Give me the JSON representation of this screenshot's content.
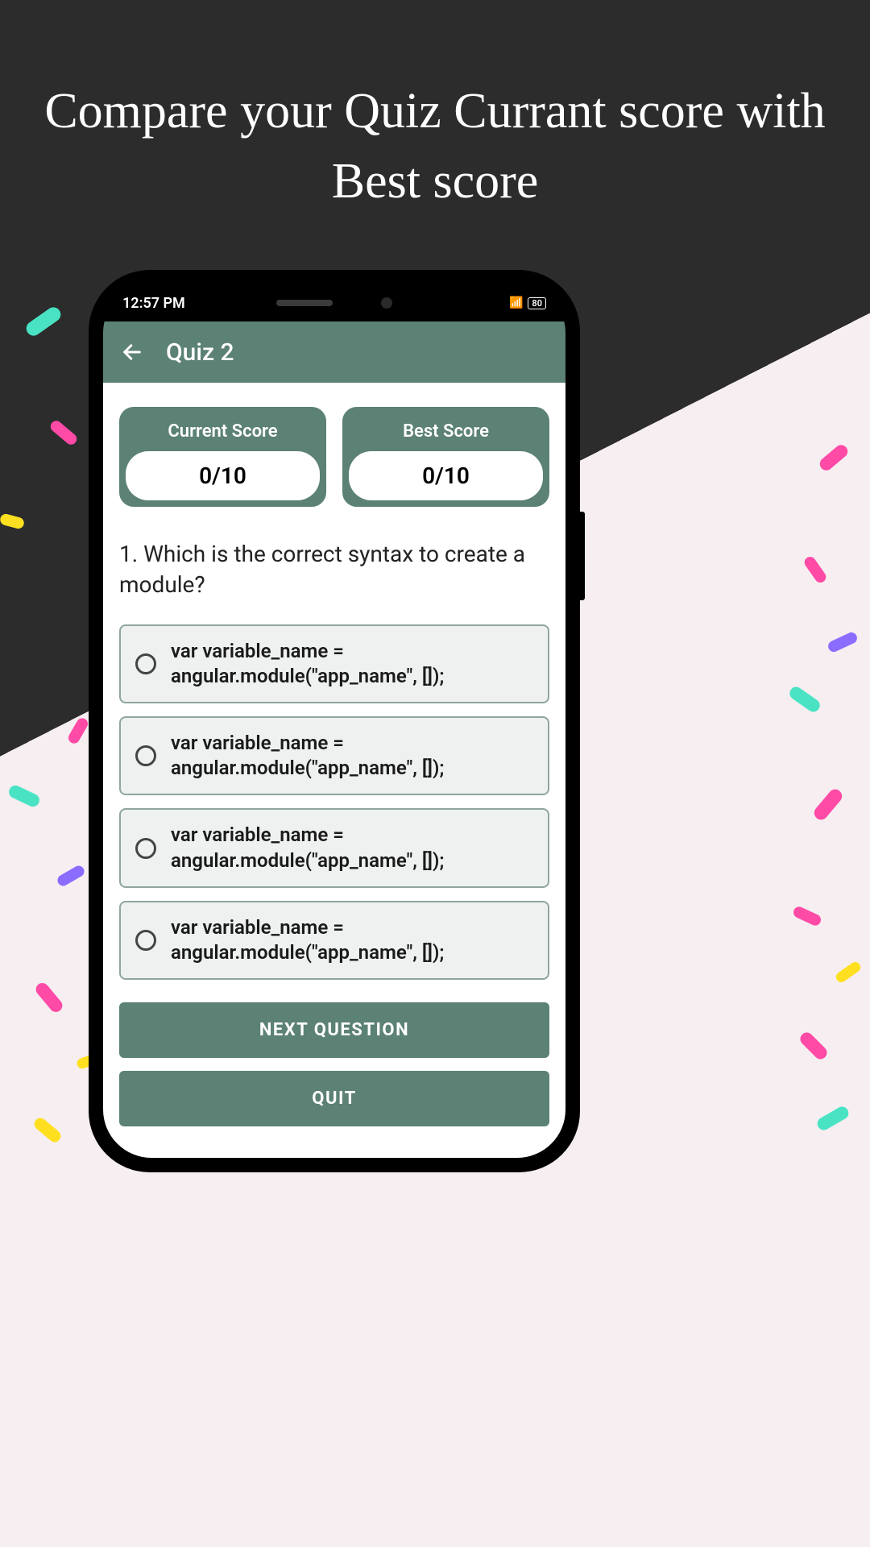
{
  "headline": "Compare your Quiz Currant score with Best score",
  "statusBar": {
    "time": "12:57 PM",
    "battery": "80"
  },
  "appBar": {
    "title": "Quiz 2"
  },
  "scores": {
    "current": {
      "label": "Current Score",
      "value": "0/10"
    },
    "best": {
      "label": "Best Score",
      "value": "0/10"
    }
  },
  "question": {
    "text": "1. Which is the correct syntax to create a module?",
    "options": [
      "var variable_name = angular.module(\"app_name\", []);",
      "var variable_name = angular.module(\"app_name\", []);",
      "var variable_name = angular.module(\"app_name\", []);",
      "var variable_name = angular.module(\"app_name\", []);"
    ]
  },
  "buttons": {
    "next": "NEXT QUESTION",
    "quit": "QUIT"
  }
}
